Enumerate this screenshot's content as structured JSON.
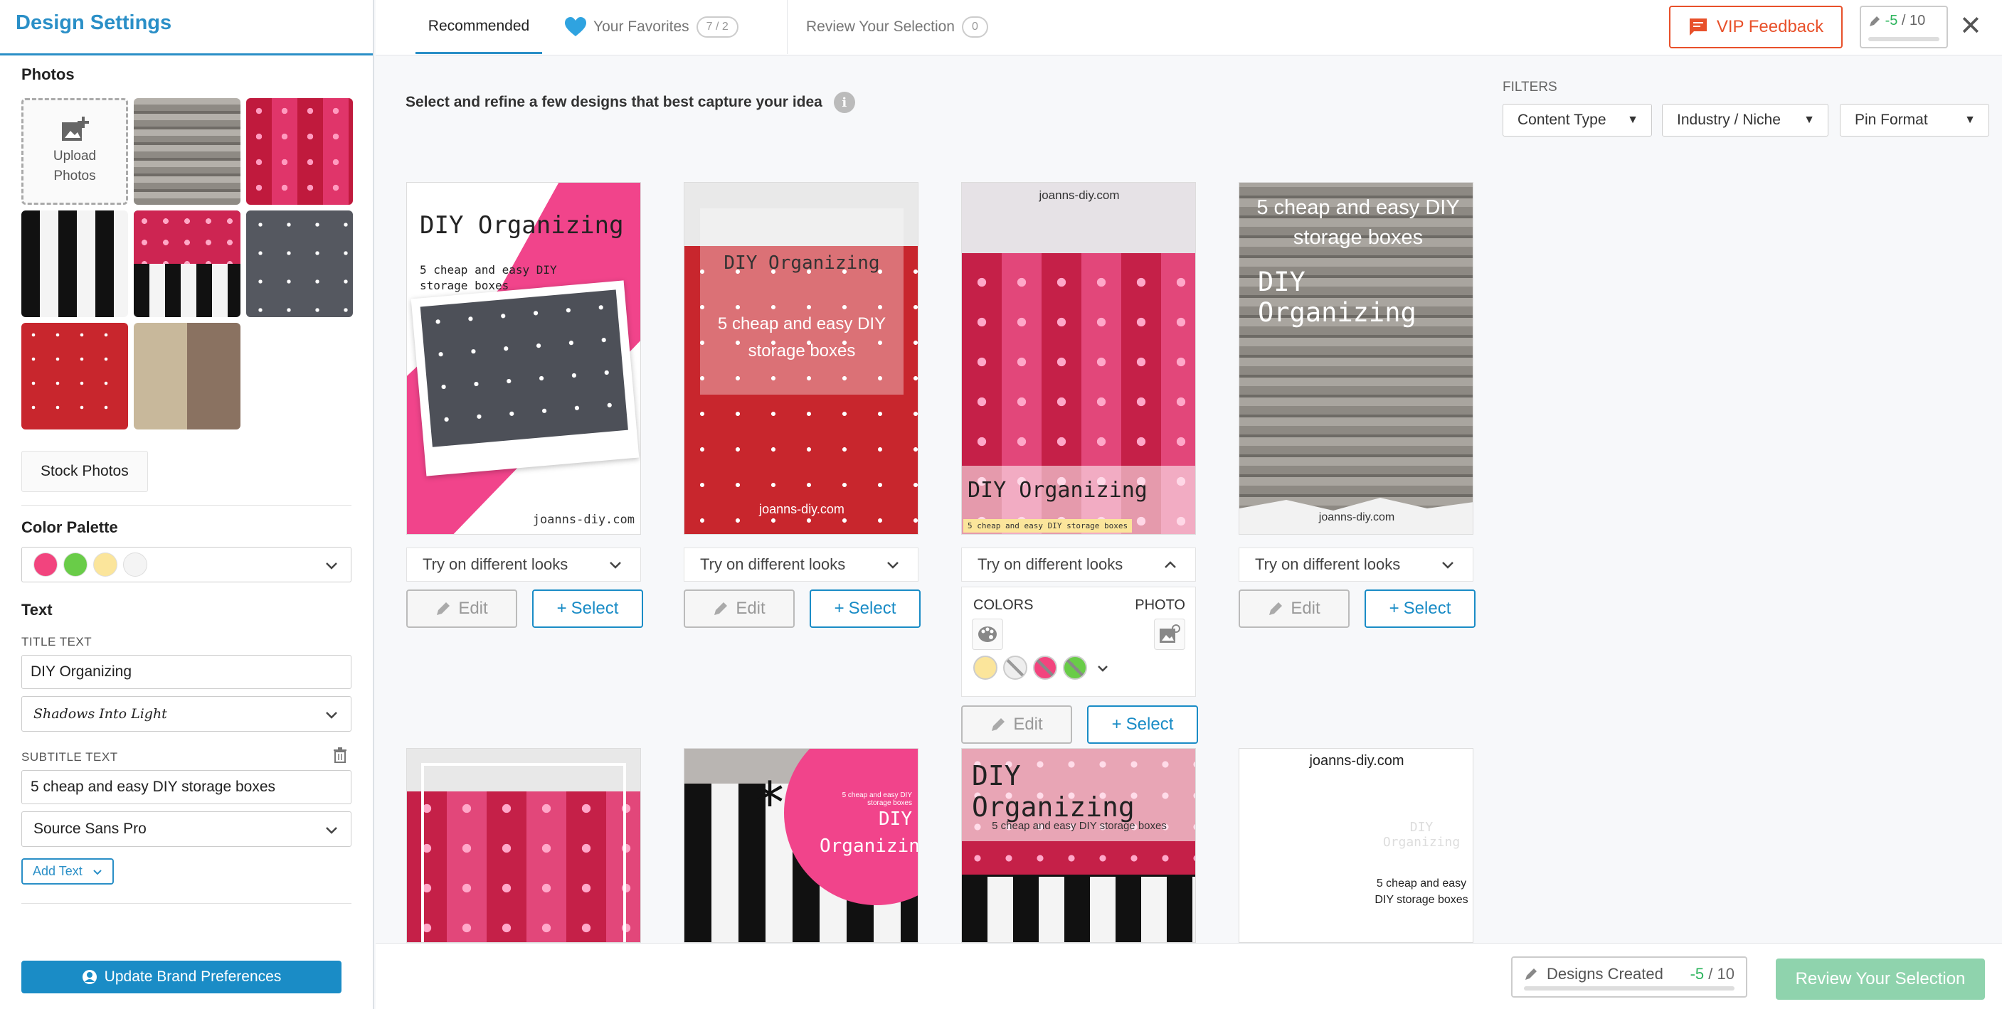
{
  "sidebar": {
    "title": "Design Settings",
    "photos_title": "Photos",
    "upload_label_1": "Upload",
    "upload_label_2": "Photos",
    "stock_photos": "Stock Photos",
    "color_palette_title": "Color Palette",
    "palette_colors": [
      "#f2447e",
      "#69cc48",
      "#fbe59b",
      "#f4f4f4"
    ],
    "text_title": "Text",
    "title_text_label": "TITLE TEXT",
    "title_text_value": "DIY Organizing",
    "title_font": "Shadows Into Light",
    "subtitle_text_label": "SUBTITLE TEXT",
    "subtitle_text_value": "5 cheap and easy DIY storage boxes",
    "subtitle_font": "Source Sans Pro",
    "add_text": "Add Text",
    "update_brand": "Update Brand Preferences"
  },
  "topbar": {
    "tab_recommended": "Recommended",
    "tab_favorites": "Your Favorites",
    "favorites_count": "7 / 2",
    "tab_review": "Review Your Selection",
    "review_count": "0",
    "vip_feedback": "VIP Feedback",
    "counter_used": "-5",
    "counter_total": "/ 10"
  },
  "main": {
    "intro": "Select and refine a few designs that best capture your idea",
    "filters_label": "FILTERS",
    "filters": [
      "Content Type",
      "Industry / Niche",
      "Pin Format"
    ]
  },
  "cards": {
    "looks_label": "Try on different looks",
    "edit_label": "Edit",
    "select_label": "Select",
    "c1_title": "DIY Organizing",
    "c1_sub": "5 cheap and easy DIY storage boxes",
    "c1_site": "joanns-diy.com",
    "c2_title": "DIY Organizing",
    "c2_sub": "5 cheap and easy DIY storage boxes",
    "c2_site": "joanns-diy.com",
    "c3_site": "joanns-diy.com",
    "c3_title": "DIY Organizing",
    "c3_sub": "5 cheap and easy DIY storage boxes",
    "c4_sub": "5 cheap and easy DIY storage boxes",
    "c4_title": "DIY Organizing",
    "c4_site": "joanns-diy.com",
    "c6_sub": "5 cheap and easy DIY storage boxes",
    "c6_title": "DIY Organizing",
    "c7_title": "DIY Organizing",
    "c7_sub": "5 cheap and easy DIY storage boxes",
    "c8_site": "joanns-diy.com",
    "c8_title": "DIY Organizing",
    "c8_sub": "5 cheap and easy DIY storage boxes"
  },
  "looks_panel": {
    "colors_label": "COLORS",
    "photo_label": "PHOTO",
    "swatches": [
      "#fbe59b",
      "#e0e0e0",
      "#f2447e",
      "#69cc48"
    ]
  },
  "bottombar": {
    "designs_created": "Designs Created",
    "count_used": "-5",
    "count_total": "/ 10",
    "review_button": "Review Your Selection"
  },
  "colors": {
    "accent": "#2a8fc7",
    "vip": "#e8502a",
    "pink": "#f2447e",
    "review_green": "#8fd3ad"
  }
}
